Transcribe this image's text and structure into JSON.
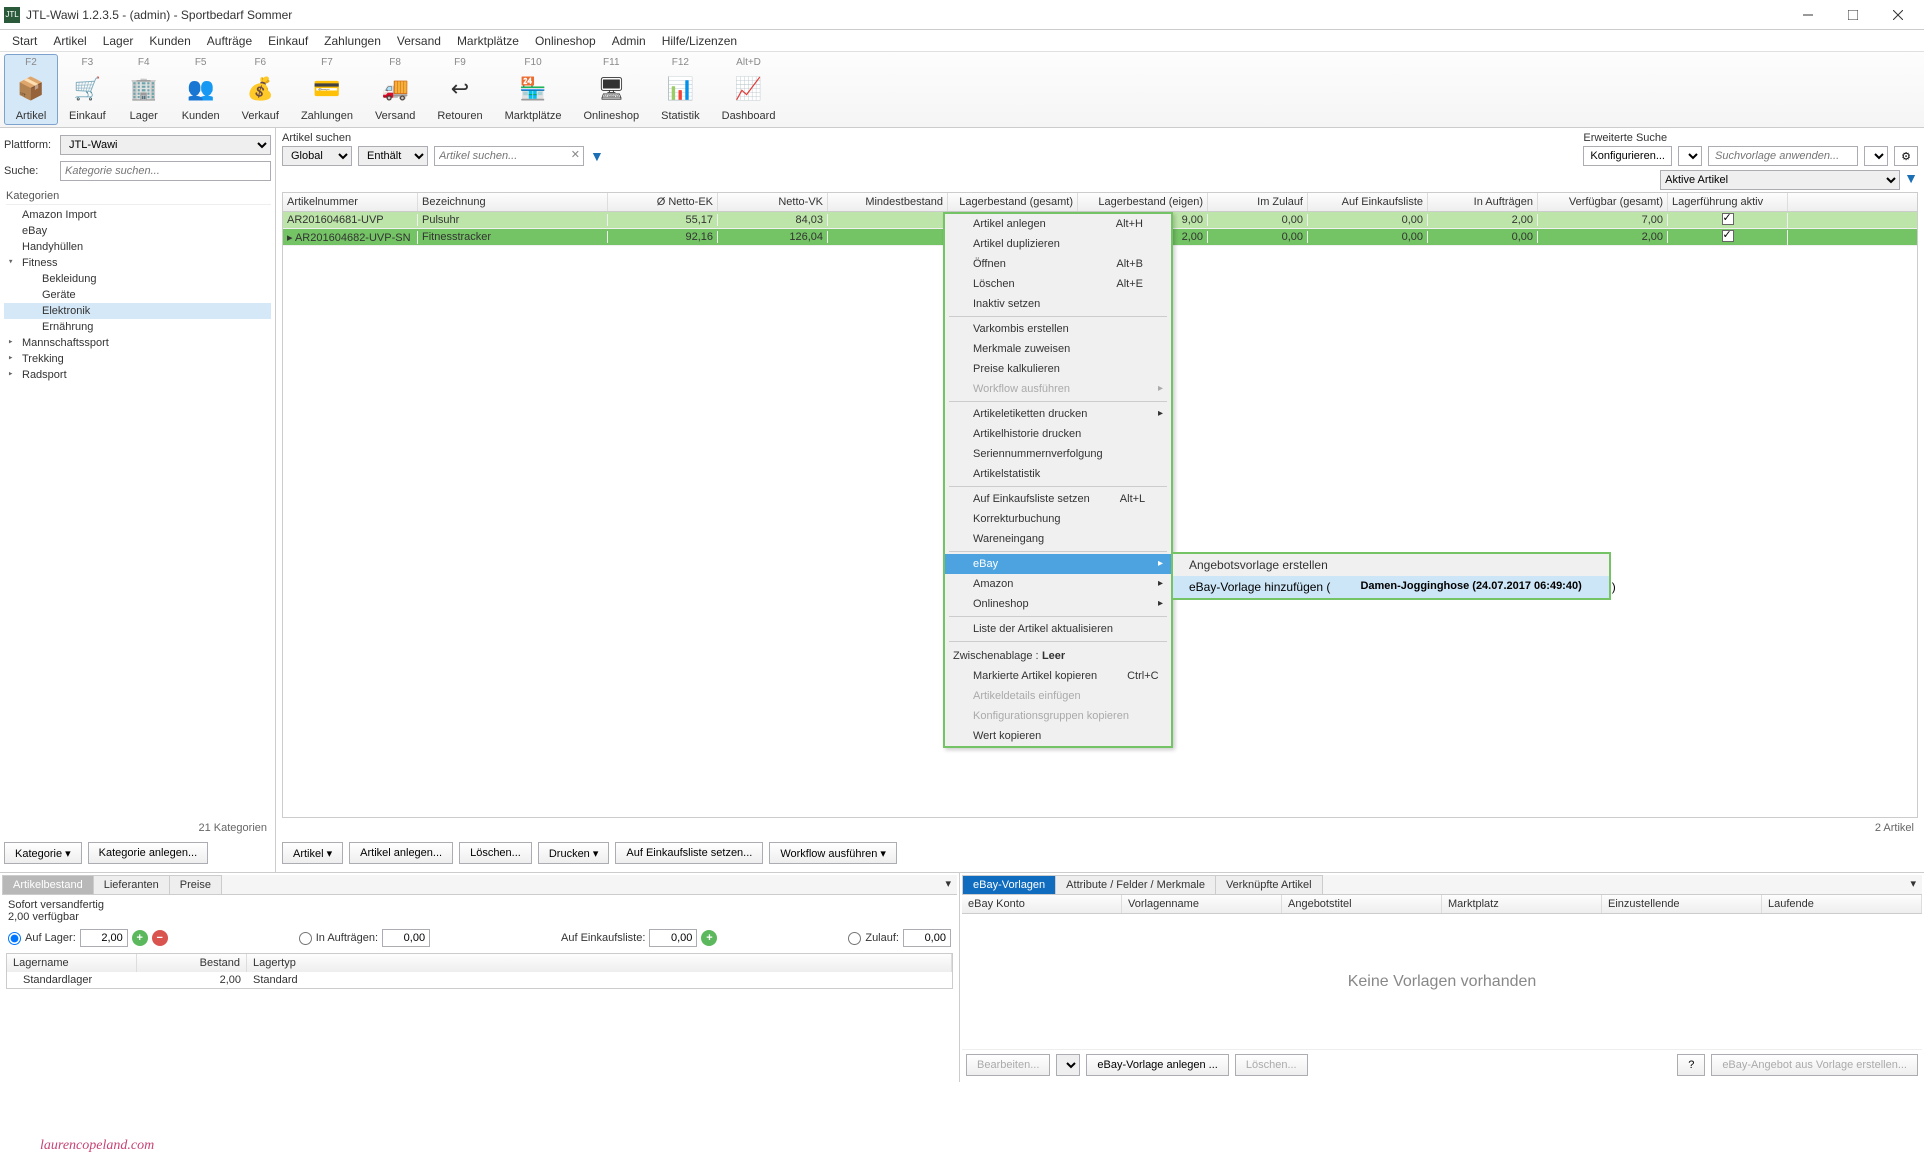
{
  "title": "JTL-Wawi 1.2.3.5 - (admin) - Sportbedarf Sommer",
  "menu": [
    "Start",
    "Artikel",
    "Lager",
    "Kunden",
    "Aufträge",
    "Einkauf",
    "Zahlungen",
    "Versand",
    "Marktplätze",
    "Onlineshop",
    "Admin",
    "Hilfe/Lizenzen"
  ],
  "ribbon": [
    {
      "hot": "F2",
      "label": "Artikel",
      "active": true
    },
    {
      "hot": "F3",
      "label": "Einkauf"
    },
    {
      "hot": "F4",
      "label": "Lager"
    },
    {
      "hot": "F5",
      "label": "Kunden"
    },
    {
      "hot": "F6",
      "label": "Verkauf"
    },
    {
      "hot": "F7",
      "label": "Zahlungen"
    },
    {
      "hot": "F8",
      "label": "Versand"
    },
    {
      "hot": "F9",
      "label": "Retouren"
    },
    {
      "hot": "F10",
      "label": "Marktplätze"
    },
    {
      "hot": "F11",
      "label": "Onlineshop"
    },
    {
      "hot": "F12",
      "label": "Statistik"
    },
    {
      "hot": "Alt+D",
      "label": "Dashboard"
    }
  ],
  "left": {
    "platform_label": "Plattform:",
    "platform_value": "JTL-Wawi",
    "search_label": "Suche:",
    "search_placeholder": "Kategorie suchen...",
    "cat_header": "Kategorien",
    "tree": [
      {
        "label": "Amazon Import",
        "lvl": 1
      },
      {
        "label": "eBay",
        "lvl": 1
      },
      {
        "label": "Handyhüllen",
        "lvl": 1
      },
      {
        "label": "Fitness",
        "lvl": 1,
        "exp": true
      },
      {
        "label": "Bekleidung",
        "lvl": 2
      },
      {
        "label": "Geräte",
        "lvl": 2
      },
      {
        "label": "Elektronik",
        "lvl": 2,
        "sel": true
      },
      {
        "label": "Ernährung",
        "lvl": 2
      },
      {
        "label": "Mannschaftssport",
        "lvl": 1,
        "col": true
      },
      {
        "label": "Trekking",
        "lvl": 1,
        "col": true
      },
      {
        "label": "Radsport",
        "lvl": 1,
        "col": true
      }
    ],
    "footer": "21 Kategorien",
    "btn_cat": "Kategorie  ▾",
    "btn_new": "Kategorie anlegen..."
  },
  "search": {
    "label": "Artikel suchen",
    "scope": "Global",
    "mode": "Enthält",
    "placeholder": "Artikel suchen...",
    "adv_label": "Erweiterte Suche",
    "btn_cfg": "Konfigurieren...",
    "btn_tpl": "Suchvorlage anwenden...",
    "active_filter": "Aktive Artikel"
  },
  "grid": {
    "cols": [
      "Artikelnummer",
      "Bezeichnung",
      "Ø Netto-EK",
      "Netto-VK",
      "Mindestbestand",
      "Lagerbestand (gesamt)",
      "Lagerbestand (eigen)",
      "Im Zulauf",
      "Auf Einkaufsliste",
      "In Aufträgen",
      "Verfügbar (gesamt)",
      "Lagerführung aktiv"
    ],
    "rows": [
      {
        "sel": 1,
        "c": [
          "AR201604682-UVP-SN",
          "Fitnesstracker",
          "92,16",
          "126,04",
          "",
          "",
          "2,00",
          "0,00",
          "0,00",
          "0,00",
          "2,00",
          "✓"
        ]
      },
      {
        "sel": 2,
        "c": [
          "AR201604681-UVP",
          "Pulsuhr",
          "55,17",
          "84,03",
          "",
          "",
          "9,00",
          "0,00",
          "0,00",
          "2,00",
          "7,00",
          "✓"
        ]
      }
    ],
    "footer": "2 Artikel",
    "btns": [
      "Artikel  ▾",
      "Artikel anlegen...",
      "Löschen...",
      "Drucken  ▾",
      "Auf Einkaufsliste setzen...",
      "Workflow ausführen  ▾"
    ]
  },
  "ctx": {
    "items": [
      {
        "l": "Artikel anlegen",
        "s": "Alt+H"
      },
      {
        "l": "Artikel duplizieren"
      },
      {
        "l": "Öffnen",
        "s": "Alt+B"
      },
      {
        "l": "Löschen",
        "s": "Alt+E"
      },
      {
        "l": "Inaktiv setzen"
      },
      {
        "sep": true
      },
      {
        "l": "Varkombis erstellen"
      },
      {
        "l": "Merkmale zuweisen"
      },
      {
        "l": "Preise kalkulieren"
      },
      {
        "l": "Workflow ausführen",
        "dis": true,
        "sub": true
      },
      {
        "sep": true
      },
      {
        "l": "Artikeletiketten drucken",
        "sub": true
      },
      {
        "l": "Artikelhistorie drucken"
      },
      {
        "l": "Seriennummernverfolgung"
      },
      {
        "l": "Artikelstatistik"
      },
      {
        "sep": true
      },
      {
        "l": "Auf Einkaufsliste setzen",
        "s": "Alt+L"
      },
      {
        "l": "Korrekturbuchung"
      },
      {
        "l": "Wareneingang"
      },
      {
        "sep": true
      },
      {
        "l": "eBay",
        "sub": true,
        "hov": true
      },
      {
        "l": "Amazon",
        "sub": true
      },
      {
        "l": "Onlineshop",
        "sub": true
      },
      {
        "sep": true
      },
      {
        "l": "Liste der Artikel aktualisieren"
      }
    ],
    "clip_hdr_a": "Zwischenablage :",
    "clip_hdr_b": "Leer",
    "clip": [
      {
        "l": "Markierte Artikel kopieren",
        "s": "Ctrl+C"
      },
      {
        "l": "Artikeldetails einfügen",
        "dis": true
      },
      {
        "l": "Konfigurationsgruppen kopieren",
        "dis": true
      },
      {
        "l": "Wert kopieren"
      }
    ],
    "sub_items": [
      {
        "l": "Angebotsvorlage erstellen"
      },
      {
        "l_a": "eBay-Vorlage hinzufügen (",
        "l_b": "Damen-Jogginghose  (24.07.2017 06:49:40)",
        "l_c": " )",
        "hov": true
      }
    ]
  },
  "botleft": {
    "tabs": [
      "Artikelbestand",
      "Lieferanten",
      "Preise"
    ],
    "ready_a": "Sofort versandfertig",
    "ready_b": "2,00 verfügbar",
    "lager_lbl": "Auf Lager:",
    "lager_val": "2,00",
    "auftr_lbl": "In Aufträgen:",
    "auftr_val": "0,00",
    "ekl_lbl": "Auf Einkaufsliste:",
    "ekl_val": "0,00",
    "zul_lbl": "Zulauf:",
    "zul_val": "0,00",
    "sub_cols": [
      "Lagername",
      "Bestand",
      "Lagertyp"
    ],
    "sub_row": [
      "Standardlager",
      "2,00",
      "Standard"
    ],
    "watermark": "laurencopeland.com"
  },
  "botright": {
    "tabs": [
      "eBay-Vorlagen",
      "Attribute / Felder / Merkmale",
      "Verknüpfte Artikel"
    ],
    "cols": [
      "eBay Konto",
      "Vorlagenname",
      "Angebotstitel",
      "Marktplatz",
      "Einzustellende",
      "Laufende"
    ],
    "empty": "Keine Vorlagen vorhanden",
    "btns": {
      "edit": "Bearbeiten...",
      "new": "eBay-Vorlage anlegen ...",
      "del": "Löschen...",
      "help": "?",
      "offer": "eBay-Angebot aus Vorlage erstellen..."
    }
  }
}
